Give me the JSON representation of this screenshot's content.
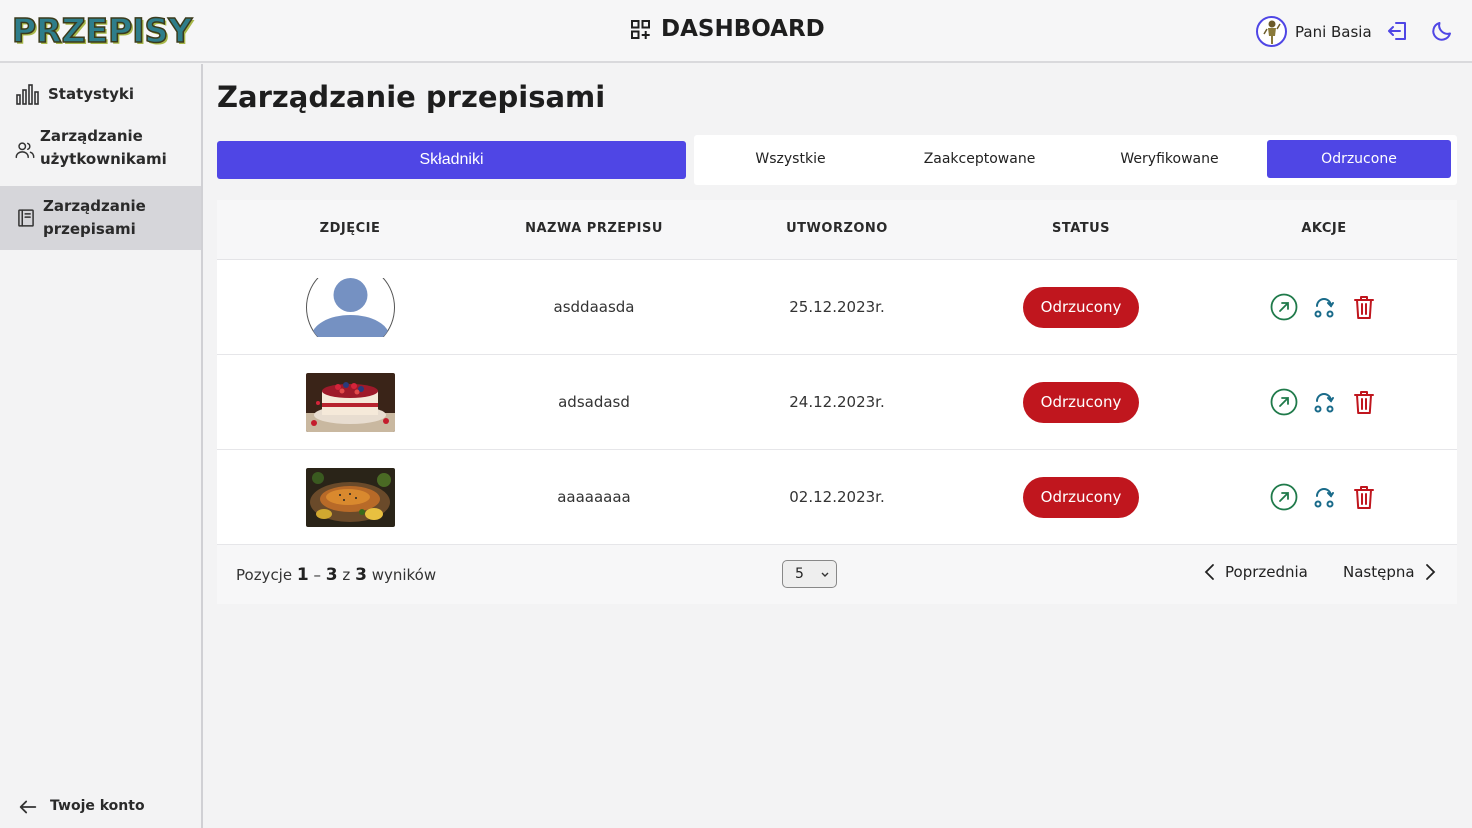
{
  "header": {
    "logo": "PRZEPISY",
    "title": "DASHBOARD",
    "user_name": "Pani Basia"
  },
  "sidebar": {
    "items": [
      {
        "label": "Statystyki",
        "icon": "bar-chart-icon"
      },
      {
        "label": "Zarządzanie użytkownikami",
        "line1": "Zarządzanie",
        "line2": "użytkownikami",
        "icon": "users-icon"
      },
      {
        "label": "Zarządzanie przepisami",
        "line1": "Zarządzanie",
        "line2": "przepisami",
        "icon": "book-icon",
        "active": true
      }
    ],
    "account_label": "Twoje konto"
  },
  "main": {
    "title": "Zarządzanie przepisami",
    "primary_button": "Składniki",
    "tabs": [
      {
        "label": "Wszystkie",
        "active": false
      },
      {
        "label": "Zaakceptowane",
        "active": false
      },
      {
        "label": "Weryfikowane",
        "active": false
      },
      {
        "label": "Odrzucone",
        "active": true
      }
    ]
  },
  "table": {
    "columns": [
      "ZDJĘCIE",
      "NAZWA PRZEPISU",
      "UTWORZONO",
      "STATUS",
      "AKCJE"
    ],
    "rows": [
      {
        "image": "placeholder-avatar",
        "name": "asddaasda",
        "created": "25.12.2023r.",
        "status": "Odrzucony"
      },
      {
        "image": "cake-photo",
        "name": "adsadasd",
        "created": "24.12.2023r.",
        "status": "Odrzucony"
      },
      {
        "image": "chicken-photo",
        "name": "aaaaaaaa",
        "created": "02.12.2023r.",
        "status": "Odrzucony"
      }
    ]
  },
  "pagination": {
    "prefix": "Pozycje",
    "from": "1",
    "dash": "–",
    "to": "3",
    "of": "z",
    "total": "3",
    "suffix": "wyników",
    "page_size": "5",
    "prev": "Poprzednia",
    "next": "Następna"
  },
  "colors": {
    "accent": "#4f46e5",
    "danger": "#c0161e",
    "action_green": "#1f7a4a",
    "action_teal": "#1a6b8a",
    "action_red": "#c0161e"
  }
}
